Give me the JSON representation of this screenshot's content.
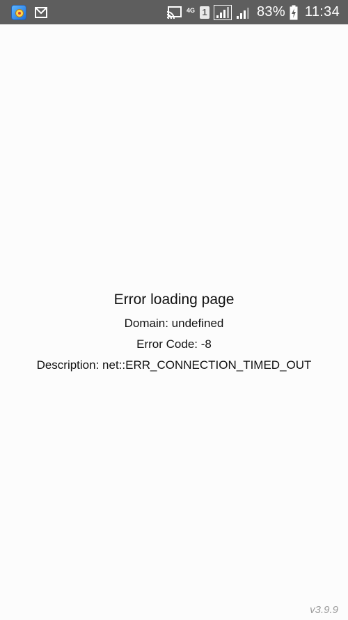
{
  "status_bar": {
    "battery_percent": "83%",
    "clock": "11:34",
    "network_type": "4G",
    "sim_slot": "1",
    "icons": [
      "app-icon",
      "gmail-icon",
      "cast-icon",
      "signal-icon",
      "battery-charging-icon"
    ]
  },
  "error": {
    "title": "Error loading page",
    "domain": "Domain: undefined",
    "code": "Error Code: -8",
    "description": "Description: net::ERR_CONNECTION_TIMED_OUT"
  },
  "footer": {
    "version": "v3.9.9"
  },
  "colors": {
    "status_bar_bg": "#5e5e5e",
    "page_bg": "#fcfcfc",
    "text": "#111111",
    "version_text": "#9a9a9a"
  }
}
